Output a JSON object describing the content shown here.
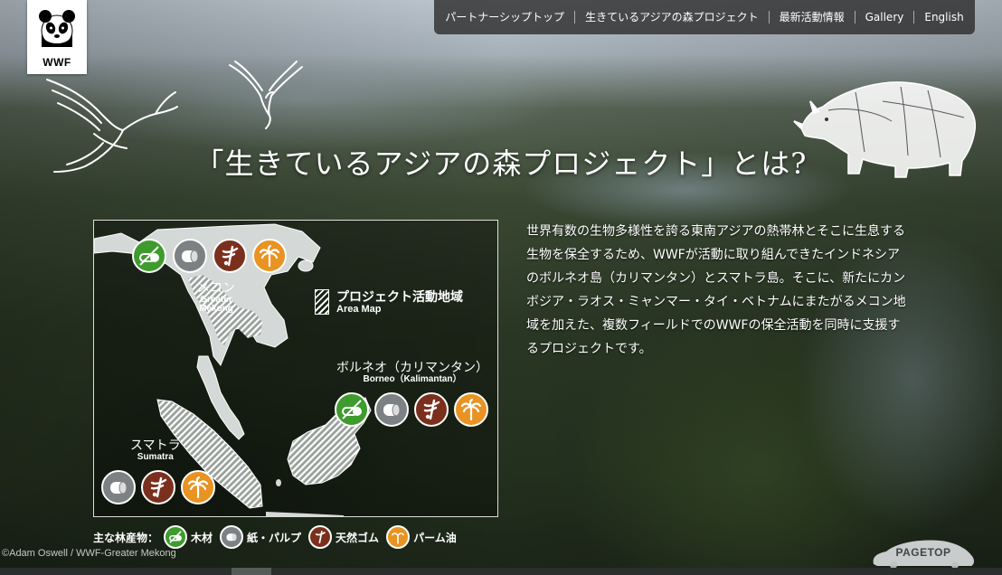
{
  "logo": {
    "text": "WWF"
  },
  "nav": {
    "items": [
      {
        "label": "パートナーシップトップ"
      },
      {
        "label": "生きているアジアの森プロジェクト"
      },
      {
        "label": "最新活動情報"
      },
      {
        "label": "Gallery"
      },
      {
        "label": "English"
      }
    ]
  },
  "hero": {
    "title": "「生きているアジアの森プロジェクト」とは?"
  },
  "map": {
    "legend_area": {
      "jp": "プロジェクト活動地域",
      "en": "Area Map"
    },
    "regions": {
      "mekong": {
        "jp": "メコン",
        "en1": "Greater",
        "en2": "Mekong"
      },
      "borneo": {
        "jp": "ボルネオ（カリマンタン）",
        "en": "Borneo（Kalimantan）"
      },
      "sumatra": {
        "jp": "スマトラ",
        "en": "Sumatra"
      }
    }
  },
  "description": "世界有数の生物多様性を誇る東南アジアの熱帯林とそこに生息する生物を保全するため、WWFが活動に取り組んできたインドネシアのボルネオ島（カリマンタン）とスマトラ島。そこに、新たにカンボジア・ラオス・ミャンマー・タイ・ベトナムにまたがるメコン地域を加えた、複数フィールドでのWWFの保全活動を同時に支援するプロジェクトです。",
  "products": {
    "label": "主な林産物：",
    "items": [
      {
        "label": "木材",
        "icon": "timber-icon",
        "color": "#3f9b2e"
      },
      {
        "label": "紙・パルプ",
        "icon": "paper-pulp-icon",
        "color": "#7d8184"
      },
      {
        "label": "天然ゴム",
        "icon": "rubber-icon",
        "color": "#7b2f1d"
      },
      {
        "label": "パーム油",
        "icon": "palm-oil-icon",
        "color": "#e89322"
      }
    ]
  },
  "credit": "©Adam Oswell / WWF-Greater Mekong",
  "pagetop": {
    "label": "PAGETOP"
  }
}
